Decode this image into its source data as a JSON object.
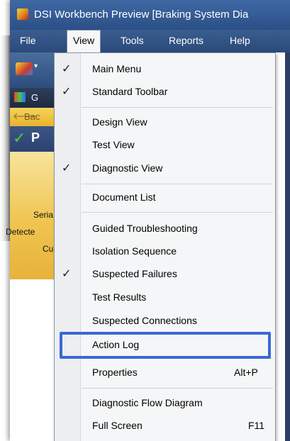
{
  "window": {
    "title": "DSI Workbench Preview [Braking System Dia"
  },
  "menubar": {
    "items": [
      "File",
      "View",
      "Tools",
      "Reports",
      "Help"
    ]
  },
  "side": {
    "toolbar_tab": "G",
    "back_label": "Bac",
    "status_letter": "P",
    "fields": [
      "Seria",
      "Detecte",
      "Cu"
    ]
  },
  "view_menu": {
    "items": [
      {
        "label": "Main Menu",
        "checked": true
      },
      {
        "label": "Standard Toolbar",
        "checked": true
      },
      {
        "label": "Design View",
        "checked": false
      },
      {
        "label": "Test View",
        "checked": false
      },
      {
        "label": "Diagnostic View",
        "checked": true
      },
      {
        "label": "Document List",
        "checked": false
      },
      {
        "label": "Guided Troubleshooting",
        "checked": false
      },
      {
        "label": "Isolation Sequence",
        "checked": false
      },
      {
        "label": "Suspected Failures",
        "checked": true
      },
      {
        "label": "Test Results",
        "checked": false
      },
      {
        "label": "Suspected Connections",
        "checked": false
      },
      {
        "label": "Action Log",
        "checked": false
      },
      {
        "label": "Properties",
        "shortcut": "Alt+P",
        "checked": false
      },
      {
        "label": "Diagnostic Flow Diagram",
        "checked": false
      },
      {
        "label": "Full Screen",
        "shortcut": "F11",
        "checked": false
      }
    ]
  },
  "check_glyph": "✓",
  "colors": {
    "highlight": "#3a68d8",
    "titlebar": "#3f69a4"
  }
}
